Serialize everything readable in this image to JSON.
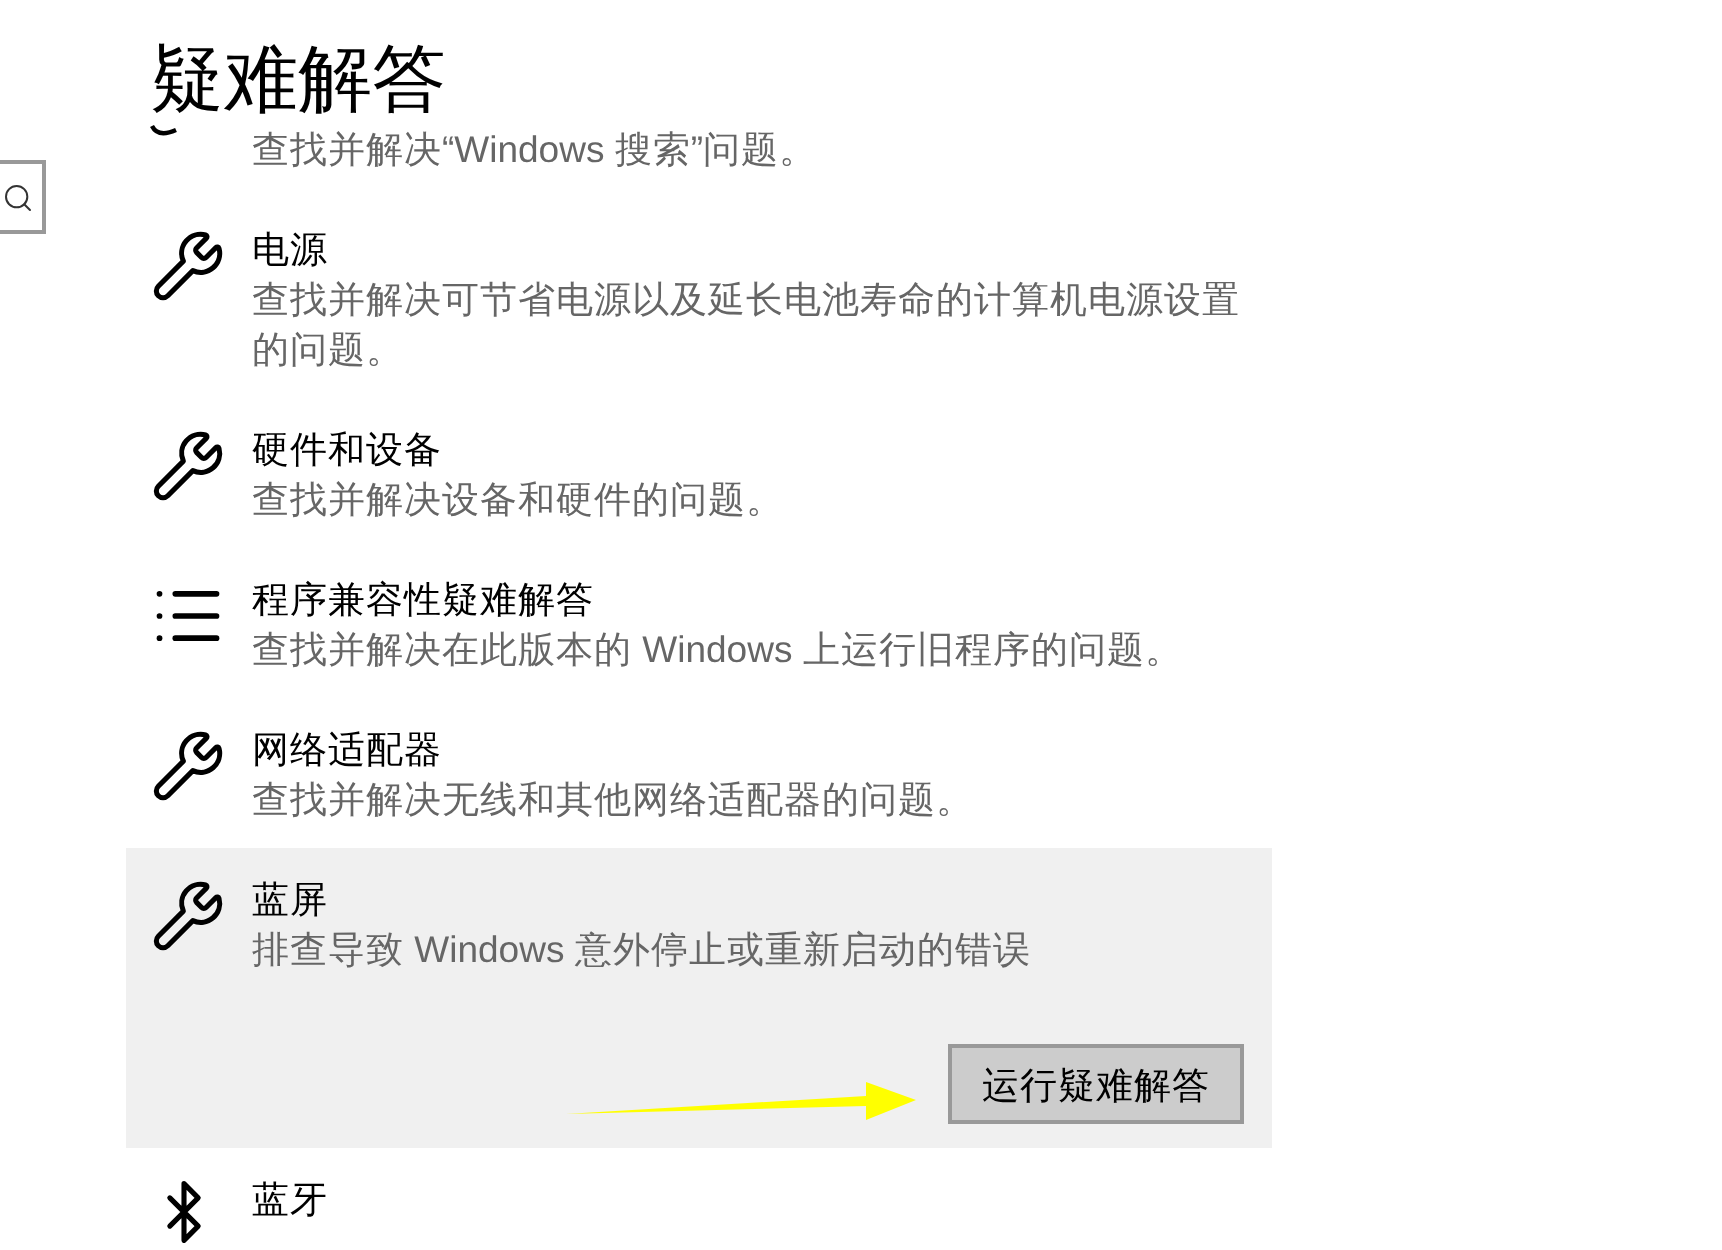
{
  "title": "疑难解答",
  "items": [
    {
      "partial": true,
      "expanded": false,
      "description": "查找并解决“Windows 搜索”问题。"
    },
    {
      "kind": "wrench",
      "partial": false,
      "expanded": false,
      "title": "电源",
      "description": "查找并解决可节省电源以及延长电池寿命的计算机电源设置的问题。"
    },
    {
      "kind": "wrench",
      "partial": false,
      "expanded": false,
      "title": "硬件和设备",
      "description": "查找并解决设备和硬件的问题。"
    },
    {
      "kind": "list",
      "partial": false,
      "expanded": false,
      "title": "程序兼容性疑难解答",
      "description": "查找并解决在此版本的 Windows 上运行旧程序的问题。"
    },
    {
      "kind": "wrench",
      "partial": false,
      "expanded": false,
      "title": "网络适配器",
      "description": "查找并解决无线和其他网络适配器的问题。"
    },
    {
      "kind": "wrench",
      "partial": false,
      "expanded": true,
      "title": "蓝屏",
      "description": "排查导致 Windows 意外停止或重新启动的错误",
      "button": "运行疑难解答"
    },
    {
      "kind": "bluetooth",
      "partial": false,
      "expanded": false,
      "title": "蓝牙"
    }
  ]
}
